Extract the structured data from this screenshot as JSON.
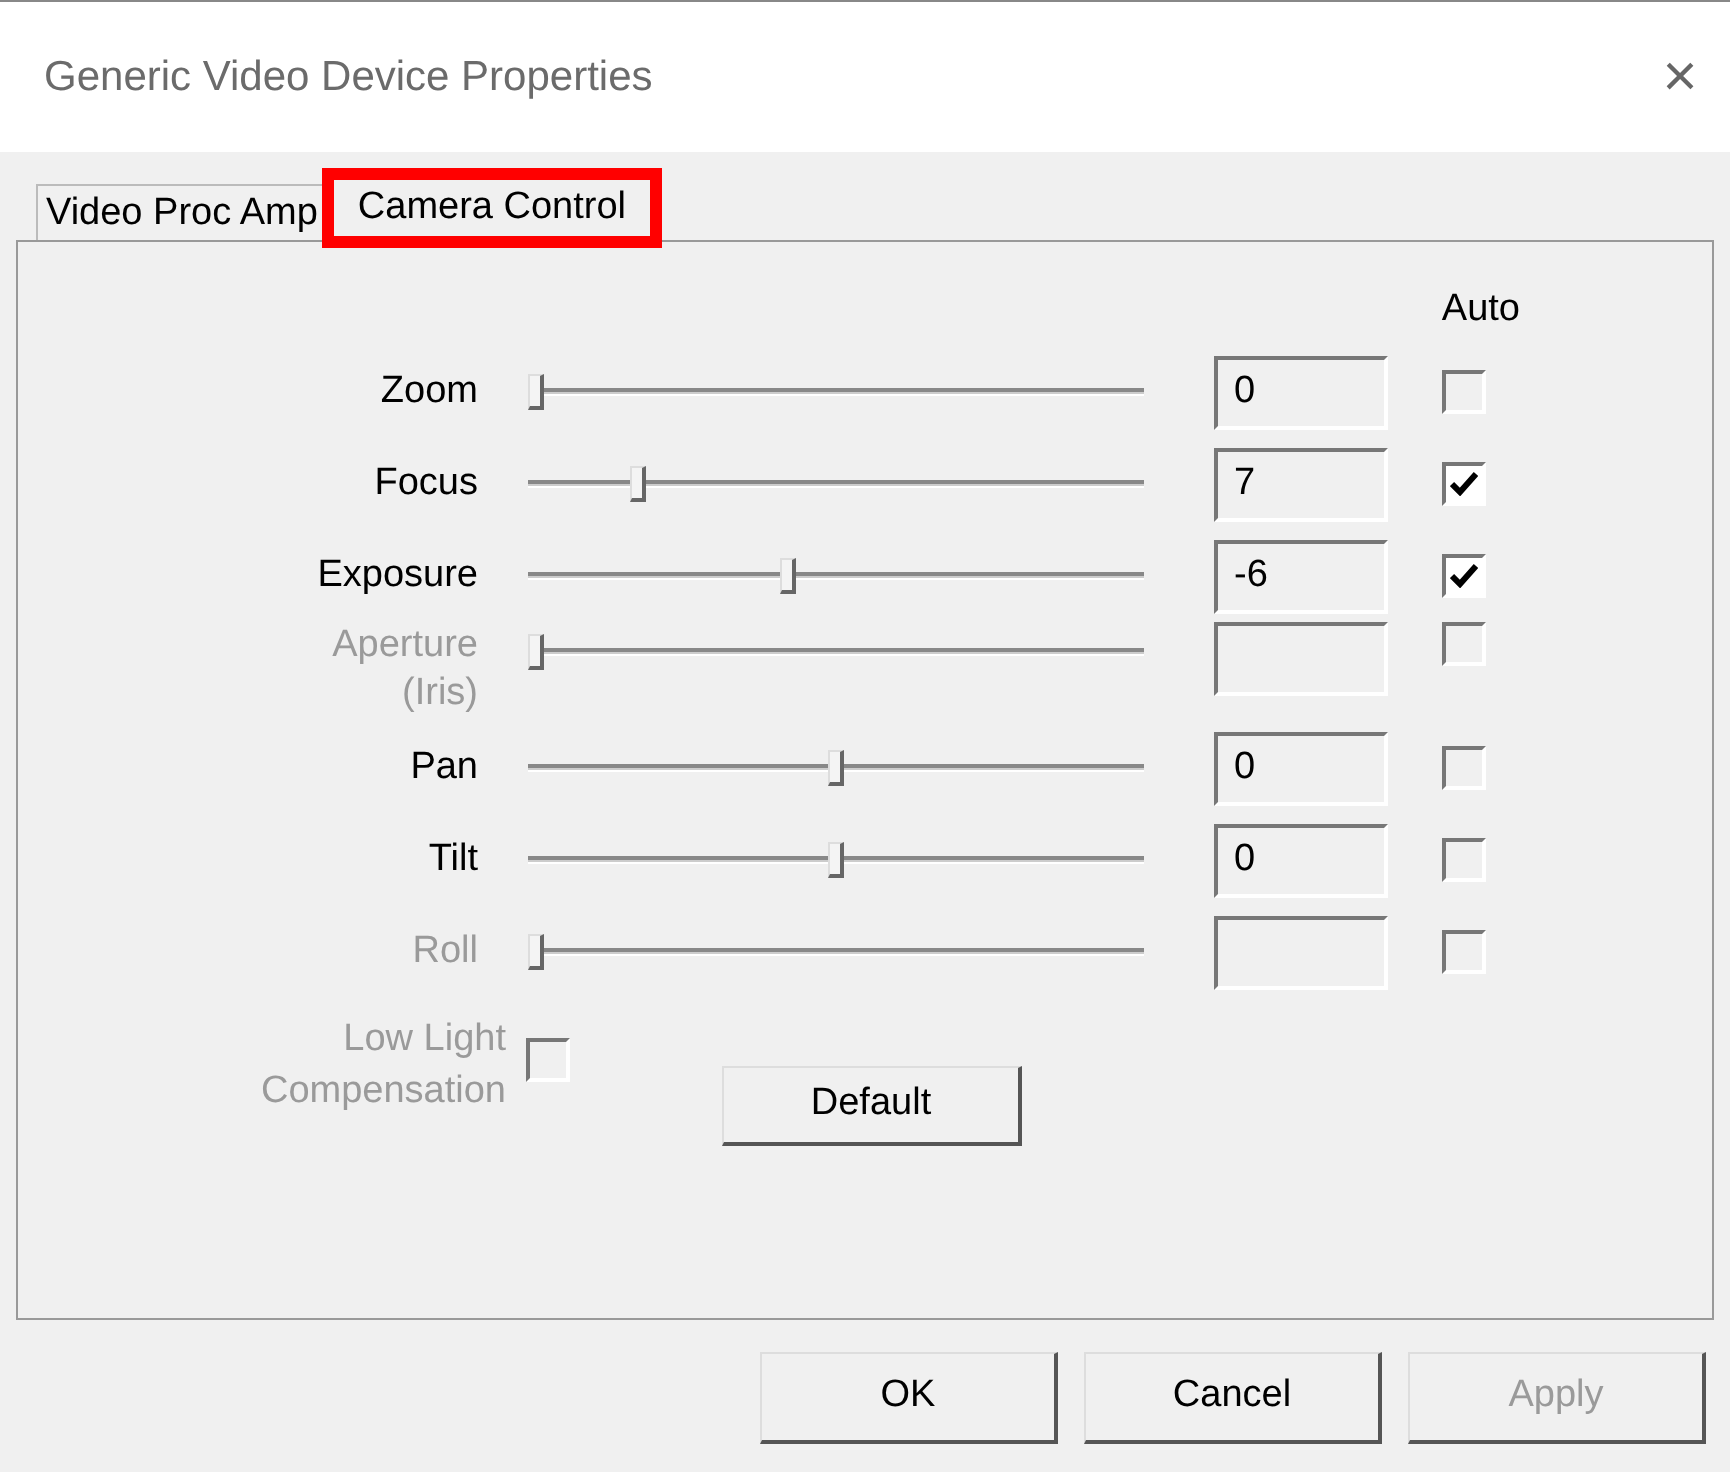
{
  "window": {
    "title": "Generic Video Device Properties",
    "close": "×"
  },
  "tabs": [
    {
      "label": "Video Proc Amp",
      "selected": false,
      "highlighted": false
    },
    {
      "label": "Camera Control",
      "selected": true,
      "highlighted": true
    }
  ],
  "auto_header": "Auto",
  "controls": [
    {
      "label": "Zoom",
      "level": 0,
      "value": "0",
      "auto": false,
      "disabled": false
    },
    {
      "label": "Focus",
      "level": 0.17,
      "value": "7",
      "auto": true,
      "disabled": false
    },
    {
      "label": "Exposure",
      "level": 0.42,
      "value": "-6",
      "auto": true,
      "disabled": false
    },
    {
      "label": "Aperture (Iris)",
      "level": 0,
      "auto": false,
      "disabled": true
    },
    {
      "label": "Pan",
      "level": 0.5,
      "value": "0",
      "auto": false,
      "disabled": false
    },
    {
      "label": "Tilt",
      "level": 0.5,
      "value": "0",
      "auto": false,
      "disabled": false
    },
    {
      "label": "Roll",
      "level": 0,
      "auto": false,
      "disabled": true
    }
  ],
  "low_light": {
    "label": "Low Light Compensation",
    "checked": false,
    "disabled": true
  },
  "default_button": {
    "label": "Default"
  },
  "buttons": [
    {
      "label": "OK",
      "disabled": false
    },
    {
      "label": "Cancel",
      "disabled": false
    },
    {
      "label": "Apply",
      "disabled": true
    }
  ]
}
